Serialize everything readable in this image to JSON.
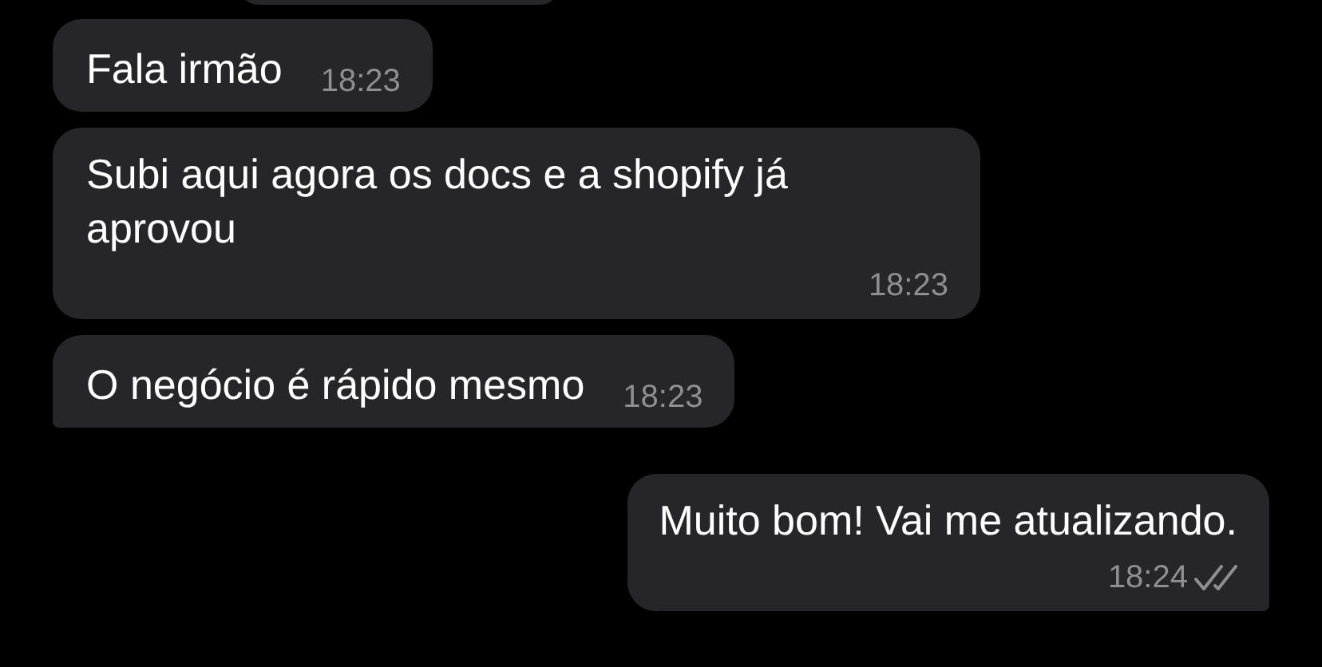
{
  "messages": [
    {
      "outgoing": false,
      "text": "Fala irmão",
      "time": "18:23",
      "tail": false,
      "time_below": false
    },
    {
      "outgoing": false,
      "text": "Subi aqui agora os docs e a shopify já aprovou",
      "time": "18:23",
      "tail": false,
      "time_below": true
    },
    {
      "outgoing": false,
      "text": "O negócio é rápido mesmo",
      "time": "18:23",
      "tail": true,
      "time_below": false
    },
    {
      "outgoing": true,
      "text": "Muito bom! Vai me atualizando.",
      "time": "18:24",
      "tail": true,
      "time_below": true,
      "read": true
    }
  ]
}
